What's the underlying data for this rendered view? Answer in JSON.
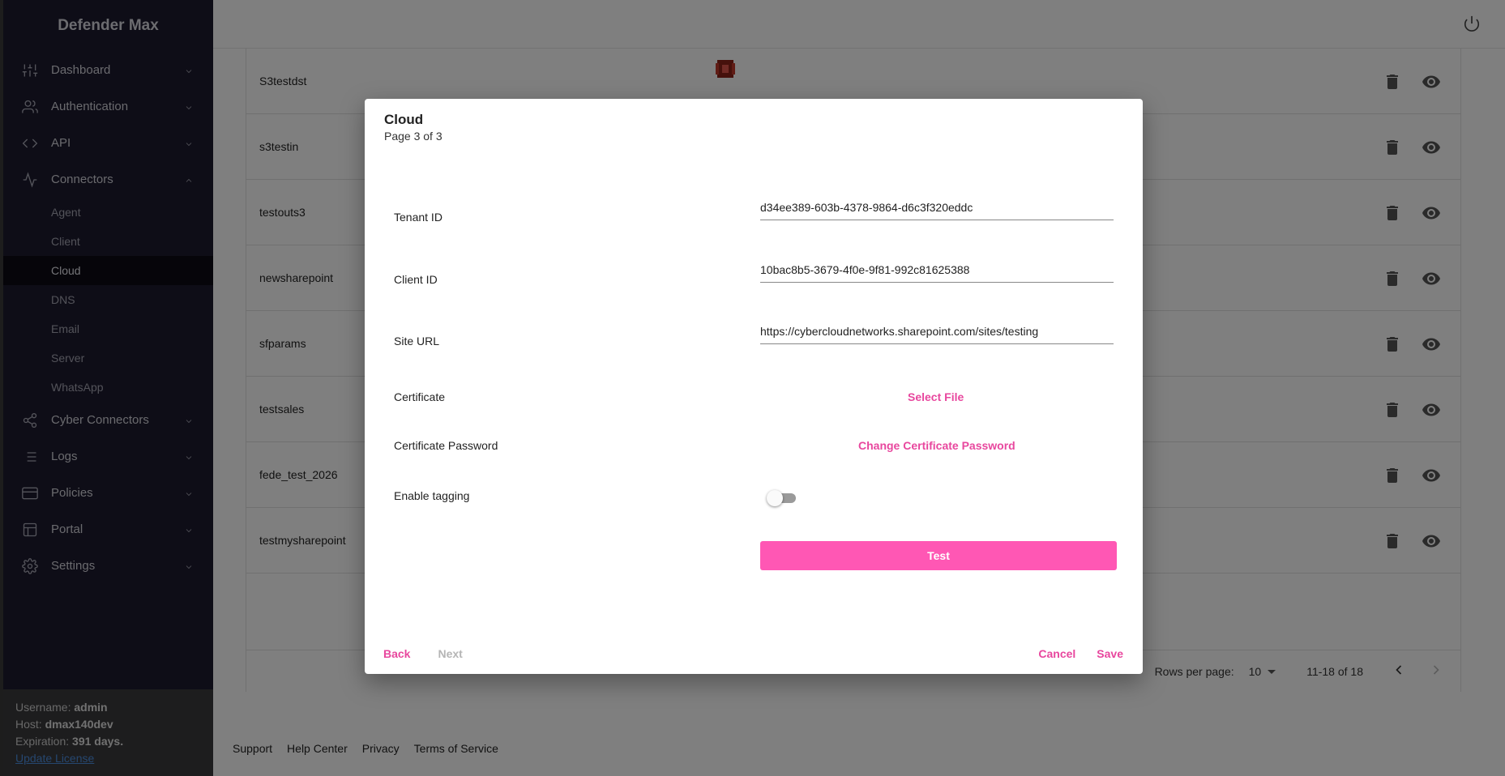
{
  "app": {
    "title": "Defender Max"
  },
  "sidebar": {
    "items": [
      {
        "label": "Dashboard",
        "icon": "sliders-icon"
      },
      {
        "label": "Authentication",
        "icon": "users-icon"
      },
      {
        "label": "API",
        "icon": "code-icon"
      },
      {
        "label": "Connectors",
        "icon": "activity-icon",
        "expanded": true
      },
      {
        "label": "Cyber Connectors",
        "icon": "share-icon"
      },
      {
        "label": "Logs",
        "icon": "list-icon"
      },
      {
        "label": "Policies",
        "icon": "card-icon"
      },
      {
        "label": "Portal",
        "icon": "layout-icon"
      },
      {
        "label": "Settings",
        "icon": "gear-icon"
      }
    ],
    "connectors_sub": [
      "Agent",
      "Client",
      "Cloud",
      "DNS",
      "Email",
      "Server",
      "WhatsApp"
    ],
    "active_sub": "Cloud"
  },
  "user": {
    "username_label": "Username:",
    "username": "admin",
    "host_label": "Host:",
    "host": "dmax140dev",
    "expiration_label": "Expiration:",
    "expiration": "391 days.",
    "update_link": "Update License"
  },
  "table": {
    "rows": [
      "S3testdst",
      "s3testin",
      "testouts3",
      "newsharepoint",
      "sfparams",
      "testsales",
      "fede_test_2026",
      "testmysharepoint"
    ]
  },
  "pager": {
    "rows_per_page_label": "Rows per page:",
    "rows_per_page": "10",
    "range": "11-18 of 18"
  },
  "footer": [
    "Support",
    "Help Center",
    "Privacy",
    "Terms of Service"
  ],
  "dialog": {
    "title": "Cloud",
    "subtitle": "Page 3 of 3",
    "tenant_label": "Tenant ID",
    "tenant_value": "d34ee389-603b-4378-9864-d6c3f320eddc",
    "client_label": "Client ID",
    "client_value": "10bac8b5-3679-4f0e-9f81-992c81625388",
    "site_label": "Site URL",
    "site_value": "https://cybercloudnetworks.sharepoint.com/sites/testing",
    "certificate_label": "Certificate",
    "select_file": "Select File",
    "cert_password_label": "Certificate Password",
    "change_password": "Change Certificate Password",
    "tagging_label": "Enable tagging",
    "tagging_enabled": false,
    "test": "Test",
    "back": "Back",
    "next": "Next",
    "cancel": "Cancel",
    "save": "Save"
  },
  "colors": {
    "accent": "#ff57b4",
    "sidebar": "#1d1b2e"
  }
}
